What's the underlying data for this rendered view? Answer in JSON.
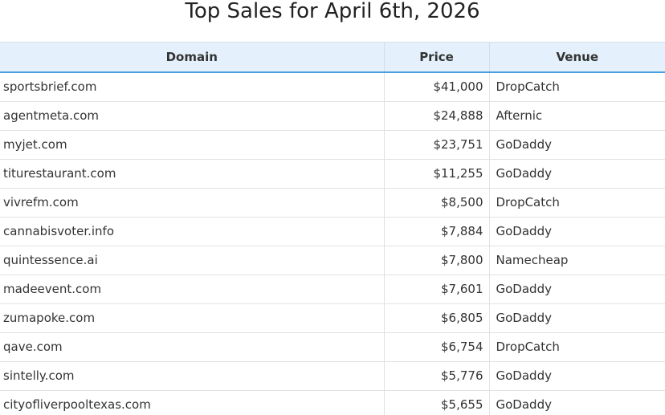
{
  "title": "Top Sales for April 6th, 2026",
  "table": {
    "headers": {
      "domain": "Domain",
      "price": "Price",
      "venue": "Venue"
    },
    "rows": [
      {
        "domain": "sportsbrief.com",
        "price": "$41,000",
        "venue": "DropCatch"
      },
      {
        "domain": "agentmeta.com",
        "price": "$24,888",
        "venue": "Afternic"
      },
      {
        "domain": "myjet.com",
        "price": "$23,751",
        "venue": "GoDaddy"
      },
      {
        "domain": "titurestaurant.com",
        "price": "$11,255",
        "venue": "GoDaddy"
      },
      {
        "domain": "vivrefm.com",
        "price": "$8,500",
        "venue": "DropCatch"
      },
      {
        "domain": "cannabisvoter.info",
        "price": "$7,884",
        "venue": "GoDaddy"
      },
      {
        "domain": "quintessence.ai",
        "price": "$7,800",
        "venue": "Namecheap"
      },
      {
        "domain": "madeevent.com",
        "price": "$7,601",
        "venue": "GoDaddy"
      },
      {
        "domain": "zumapoke.com",
        "price": "$6,805",
        "venue": "GoDaddy"
      },
      {
        "domain": "qave.com",
        "price": "$6,754",
        "venue": "DropCatch"
      },
      {
        "domain": "sintelly.com",
        "price": "$5,776",
        "venue": "GoDaddy"
      },
      {
        "domain": "cityofliverpooltexas.com",
        "price": "$5,655",
        "venue": "GoDaddy"
      }
    ]
  },
  "colors": {
    "header_bg": "#e4f1fc",
    "header_accent": "#4a9fe0",
    "row_border": "#e2e2e2"
  }
}
